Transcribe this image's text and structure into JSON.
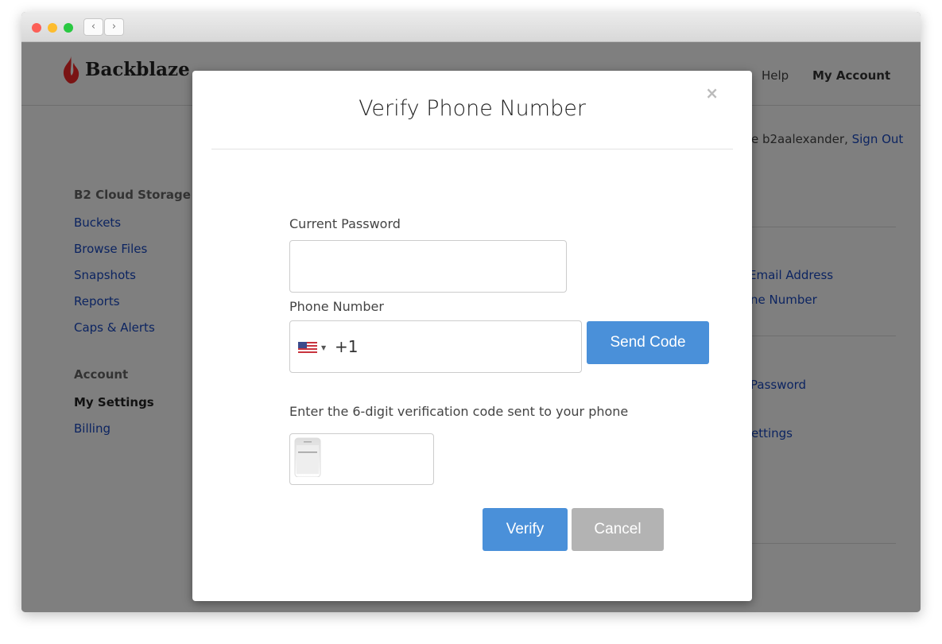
{
  "browser": {
    "back": "‹",
    "forward": "›"
  },
  "header": {
    "logo": "Backblaze",
    "nav": [
      "Help",
      "My Account"
    ]
  },
  "sidebar": {
    "sections": [
      {
        "heading": "B2 Cloud Storage",
        "items": [
          "Buckets",
          "Browse Files",
          "Snapshots",
          "Reports",
          "Caps & Alerts"
        ]
      },
      {
        "heading": "Account",
        "items": [
          "My Settings",
          "Billing"
        ],
        "active": "My Settings"
      }
    ]
  },
  "background": {
    "welcome": "e b2aalexander, ",
    "sign_out": "Sign Out",
    "links": [
      "Email Address",
      "ne Number",
      "Password",
      "ettings"
    ]
  },
  "modal": {
    "title": "Verify Phone Number",
    "close": "×",
    "password_label": "Current Password",
    "password_value": "",
    "phone_label": "Phone Number",
    "country_code": "+1",
    "country": "US",
    "send_code": "Send Code",
    "code_label": "Enter the 6-digit verification code sent to your phone",
    "code_value": "",
    "verify": "Verify",
    "cancel": "Cancel"
  },
  "colors": {
    "primary": "#4a90d9",
    "cancel": "#b3b3b3",
    "link": "#0c2461"
  }
}
